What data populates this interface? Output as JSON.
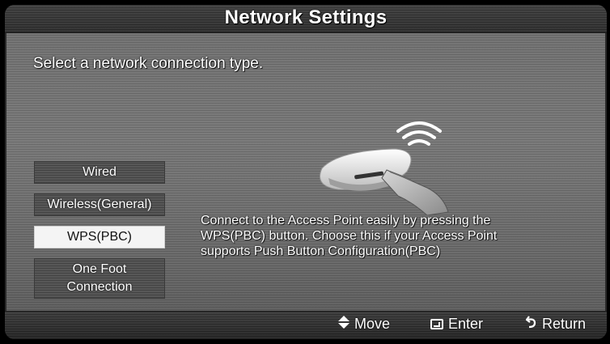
{
  "header": {
    "title": "Network Settings"
  },
  "instruction": "Select a network connection type.",
  "menu": {
    "items": [
      {
        "label": "Wired",
        "selected": false
      },
      {
        "label": "Wireless(General)",
        "selected": false
      },
      {
        "label": "WPS(PBC)",
        "selected": true
      },
      {
        "label_line1": "One Foot",
        "label_line2": "Connection",
        "selected": false
      }
    ]
  },
  "description": {
    "line1": "Connect to the Access Point easily by pressing the",
    "line2": "WPS(PBC) button. Choose this if your Access Point",
    "line3": "supports Push Button Configuration(PBC)"
  },
  "footer": {
    "move": {
      "icon": "up-down-arrows-icon",
      "label": "Move"
    },
    "enter": {
      "icon": "enter-icon",
      "label": "Enter"
    },
    "return": {
      "icon": "return-arrow-icon",
      "label": "Return"
    }
  },
  "colors": {
    "selected_bg": "#f4f4f4",
    "item_bg": "#4e4e4e",
    "bar_bg": "#2b2b2b",
    "text": "#ffffff"
  }
}
